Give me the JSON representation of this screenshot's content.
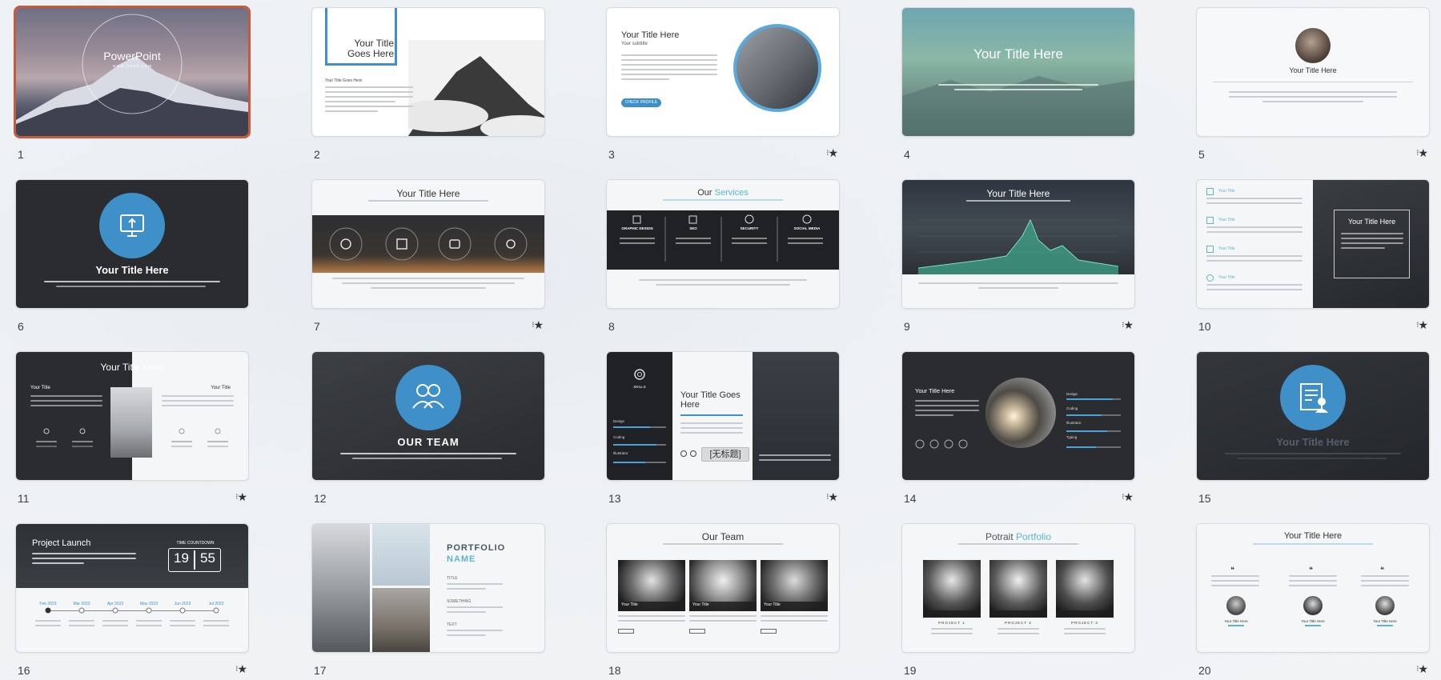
{
  "slides": [
    {
      "num": "1",
      "title": "PowerPoint",
      "subtitle": "w w w . x x x x . c o m",
      "anim": false
    },
    {
      "num": "2",
      "title": "Your Title Goes Here",
      "body": "Your Title Goes Here",
      "anim": false
    },
    {
      "num": "3",
      "title": "Your Title Here",
      "subtitle": "Your subtitle",
      "button": "CHECK PROFILE",
      "anim": true
    },
    {
      "num": "4",
      "title": "Your Title Here",
      "anim": false
    },
    {
      "num": "5",
      "title": "Your Title Here",
      "anim": true
    },
    {
      "num": "6",
      "title": "Your Title Here",
      "anim": false
    },
    {
      "num": "7",
      "title": "Your Title Here",
      "anim": true
    },
    {
      "num": "8",
      "title_a": "Our",
      "title_b": "Services",
      "services": [
        "GRAPHIC DESIGN",
        "SEO",
        "SECURITY",
        "SOCIAL MEDIA"
      ],
      "anim": false
    },
    {
      "num": "9",
      "title": "Your Title Here",
      "anim": true
    },
    {
      "num": "10",
      "title": "Your Title Here",
      "items": [
        "Your Title",
        "Your Title",
        "Your Title",
        "Your Title"
      ],
      "anim": true
    },
    {
      "num": "11",
      "title": "Your Title Here",
      "left": "Your Title",
      "right": "Your Title",
      "anim": true
    },
    {
      "num": "12",
      "title": "OUR TEAM",
      "anim": false
    },
    {
      "num": "13",
      "title": "Your Title Goes Here",
      "skills": "SKILLS",
      "bars": [
        "Design",
        "Coding",
        "Illustrator"
      ],
      "tooltip": "[无标题]",
      "anim": true
    },
    {
      "num": "14",
      "title": "Your Title Here",
      "bars": [
        "Design",
        "Coding",
        "Illustrator",
        "Typing"
      ],
      "anim": true
    },
    {
      "num": "15",
      "title": "Your Title Here",
      "anim": false
    },
    {
      "num": "16",
      "title": "Project Launch",
      "countdown_label": "TIME COUNTDOWN",
      "countdown": [
        "19",
        "55"
      ],
      "months": [
        "Feb 2023",
        "Mar 2023",
        "Apr 2023",
        "May 2023",
        "Jun 2023",
        "Jul 2023"
      ],
      "anim": true
    },
    {
      "num": "17",
      "title_a": "PORTFOLIO",
      "title_b": "NAME",
      "labels": [
        "TITLE",
        "SOMETHING",
        "TEXT"
      ],
      "anim": false
    },
    {
      "num": "18",
      "title": "Our Team",
      "cards": [
        "Your Title",
        "Your Title",
        "Your Title"
      ],
      "anim": false
    },
    {
      "num": "19",
      "title_a": "Potrait",
      "title_b": "Portfolio",
      "projects": [
        "PROJECT 1",
        "PROJECT 2",
        "PROJECT 3"
      ],
      "anim": false
    },
    {
      "num": "20",
      "title": "Your Title Here",
      "people": [
        "Your Title Here",
        "Your Title Here",
        "Your Title Here"
      ],
      "anim": true
    }
  ],
  "colors": {
    "accent": "#3f8fc9",
    "teal": "#5bb6c9",
    "selection": "#c8593a"
  },
  "icons": {
    "animation": "motion-star-icon"
  }
}
